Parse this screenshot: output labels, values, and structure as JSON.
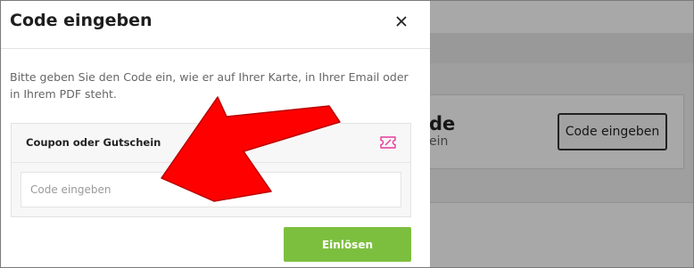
{
  "background": {
    "card_title": "de",
    "card_subtitle": "ein",
    "enter_code_button": "Code eingeben"
  },
  "modal": {
    "title": "Code eingeben",
    "close_icon": "close-icon",
    "instruction": "Bitte geben Sie den Code ein, wie er auf Ihrer Karte, in Ihrer Email oder in Ihrem PDF steht.",
    "coupon_label": "Coupon oder Gutschein",
    "coupon_icon": "ticket-icon",
    "input_placeholder": "Code eingeben",
    "input_value": "",
    "redeem_button": "Einlösen"
  },
  "annotation": {
    "arrow_color": "#ff0000"
  },
  "colors": {
    "accent_green": "#7cbf3f",
    "icon_pink": "#e6399b"
  }
}
